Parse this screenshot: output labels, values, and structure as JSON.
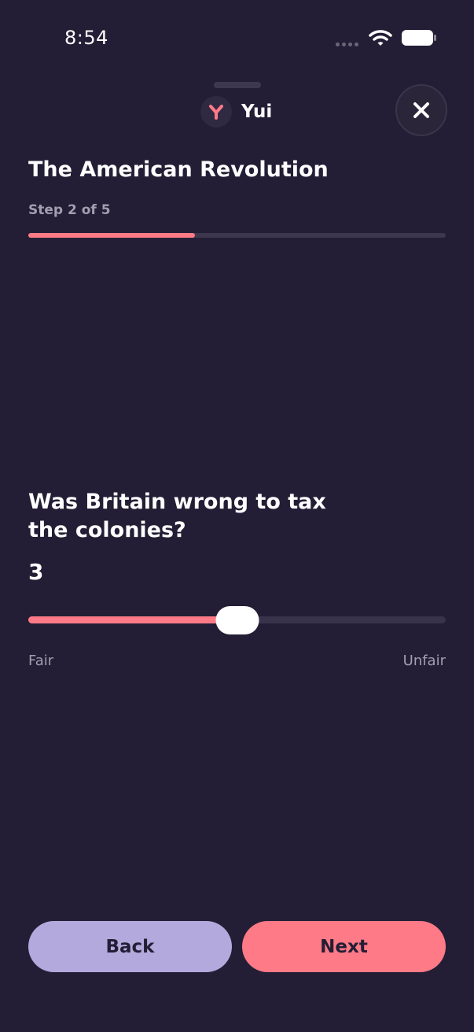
{
  "status_bar": {
    "time": "8:54"
  },
  "header": {
    "brand_name": "Yui",
    "logo_icon": "y-logo-icon",
    "close_icon": "close-icon",
    "accent_color": "#ff7a87"
  },
  "lesson": {
    "title": "The American Revolution",
    "step_label": "Step 2 of 5",
    "step_current": 2,
    "step_total": 5
  },
  "question": {
    "text": "Was Britain wrong to tax the colonies?",
    "rating_value": "3",
    "slider_fraction": 0.5,
    "min_label": "Fair",
    "max_label": "Unfair"
  },
  "buttons": {
    "back_label": "Back",
    "next_label": "Next"
  }
}
